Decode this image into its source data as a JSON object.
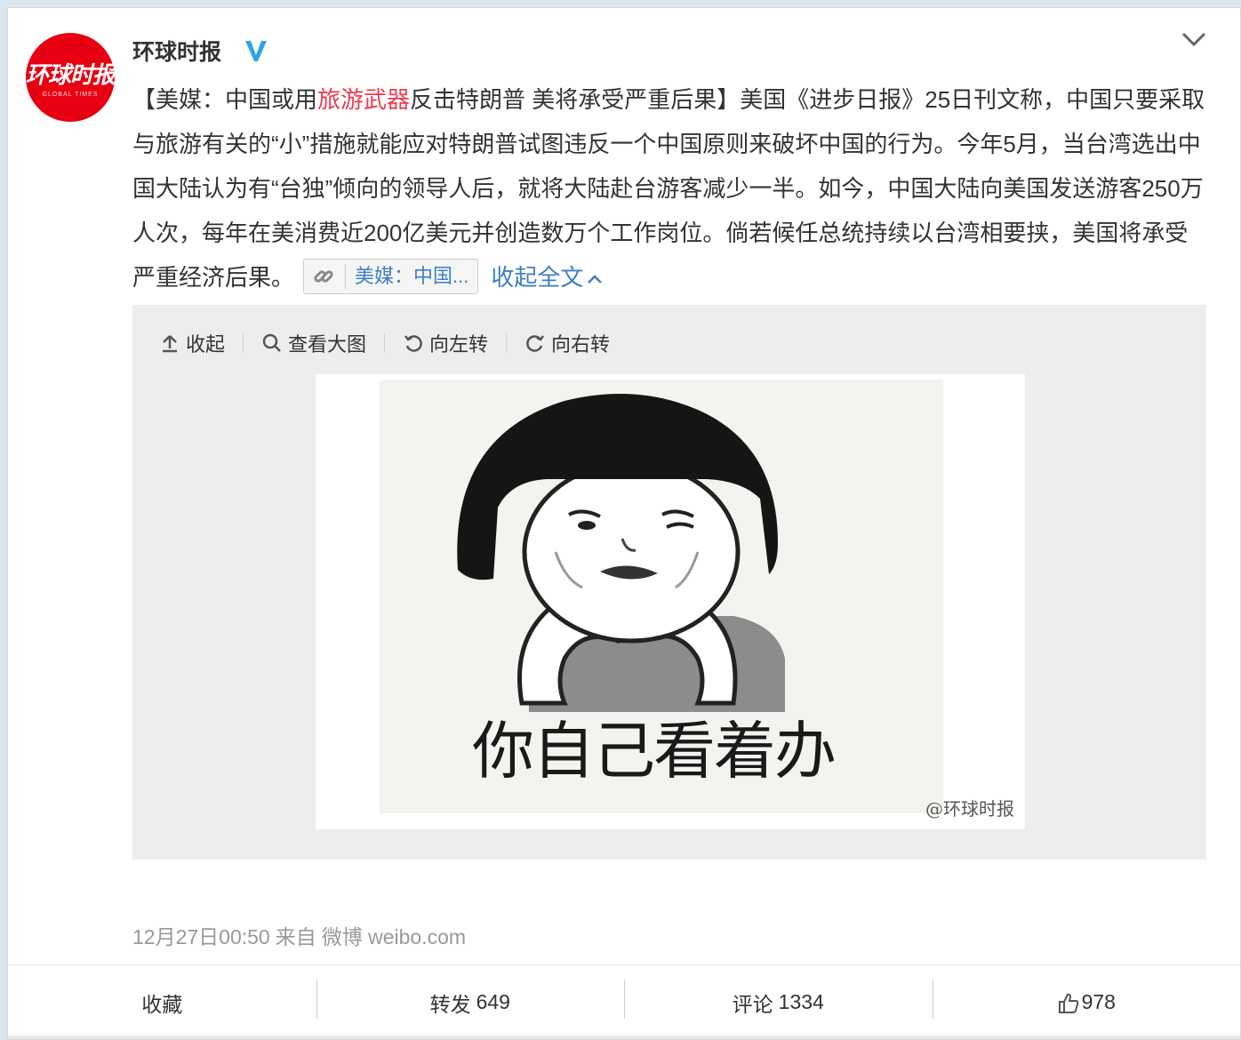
{
  "author": {
    "name": "环球时报",
    "avatar_text": "环球时报",
    "avatar_sub": "GLOBAL TIMES",
    "verified_icon": "verified-v-icon"
  },
  "post": {
    "part1": "【美媒：中国或用",
    "highlight": "旅游武器",
    "part2": "反击特朗普 美将承受严重后果】美国《进步日报》25日刊文称，中国只要采取与旅游有关的“小”措施就能应对特朗普试图违反一个中国原则来破坏中国的行为。今年5月，当台湾选出中国大陆认为有“台独”倾向的领导人后，就将大陆赴台游客减少一半。如今，中国大陆向美国发送游客250万人次，每年在美消费近200亿美元并创造数万个工作岗位。倘若候任总统持续以台湾相要挟，美国将承受严重经济后果。",
    "link_title": "美媒：中国...",
    "collapse_label": "收起全文"
  },
  "media": {
    "toolbar": {
      "collapse": "收起",
      "view_large": "查看大图",
      "rotate_left": "向左转",
      "rotate_right": "向右转"
    },
    "image_caption": "你自己看着办",
    "watermark": "@环球时报"
  },
  "meta": {
    "time": "12月27日00:50",
    "from_label": "来自",
    "source": "微博 weibo.com"
  },
  "actions": {
    "favorite": "收藏",
    "repost_label": "转发",
    "repost_count": "649",
    "comment_label": "评论",
    "comment_count": "1334",
    "like_count": "978"
  },
  "colors": {
    "accent_link": "#3d7fc1",
    "highlight": "#eb3b4f",
    "avatar_red": "#e60012",
    "verified_blue": "#2fa4e7"
  }
}
